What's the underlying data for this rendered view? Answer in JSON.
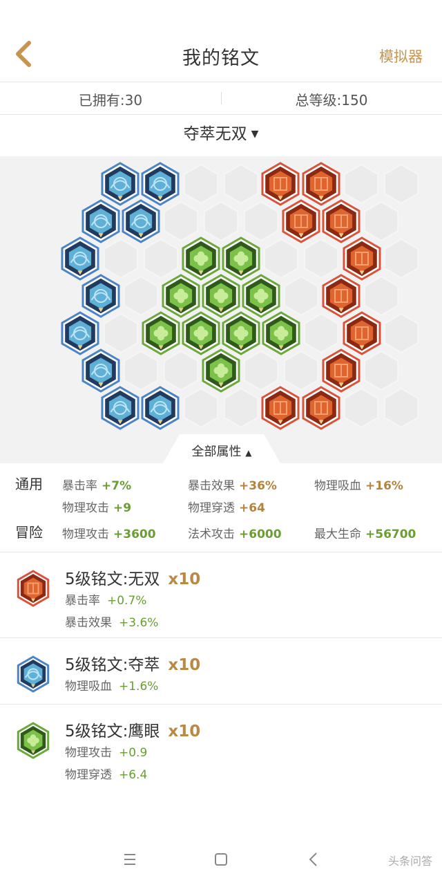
{
  "header": {
    "title": "我的铭文",
    "simulator": "模拟器"
  },
  "stats": {
    "owned": "已拥有:30",
    "total_level": "总等级:150"
  },
  "page_selector": {
    "name": "夺萃无双",
    "chevron": "⌄"
  },
  "attributes_tab": {
    "label": "全部属性",
    "chevron": "^"
  },
  "attributes": {
    "general": {
      "label": "通用",
      "items": [
        {
          "name": "暴击率",
          "value": "+7%"
        },
        {
          "name": "暴击效果",
          "value": "+36%"
        },
        {
          "name": "物理吸血",
          "value": "+16%"
        },
        {
          "name": "物理攻击",
          "value": "+9"
        },
        {
          "name": "物理穿透",
          "value": "+64"
        }
      ]
    },
    "adventure": {
      "label": "冒险",
      "items": [
        {
          "name": "物理攻击",
          "value": "+3600"
        },
        {
          "name": "法术攻击",
          "value": "+6000"
        },
        {
          "name": "最大生命",
          "value": "+56700"
        }
      ]
    }
  },
  "runes": [
    {
      "name": "5级铭文:无双",
      "count": "x10",
      "color": "red",
      "stats": [
        {
          "name": "暴击率",
          "value": "+0.7%"
        },
        {
          "name": "暴击效果",
          "value": "+3.6%"
        }
      ]
    },
    {
      "name": "5级铭文:夺萃",
      "count": "x10",
      "color": "blue",
      "stats": [
        {
          "name": "物理吸血",
          "value": "+1.6%"
        }
      ]
    },
    {
      "name": "5级铭文:鹰眼",
      "count": "x10",
      "color": "green",
      "stats": [
        {
          "name": "物理攻击",
          "value": "+0.9"
        },
        {
          "name": "物理穿透",
          "value": "+6.4"
        }
      ]
    }
  ],
  "icons": {
    "back": "chevron-left-icon",
    "nav_menu": "menu-icon",
    "nav_home": "square-icon",
    "nav_back": "triangle-left-icon"
  },
  "colors": {
    "accent": "#c79550",
    "positive": "#6a9d32",
    "red_rune": "#d9533a",
    "blue_rune": "#4a84c8",
    "green_rune": "#6aa83a"
  },
  "watermark": "头条问答"
}
